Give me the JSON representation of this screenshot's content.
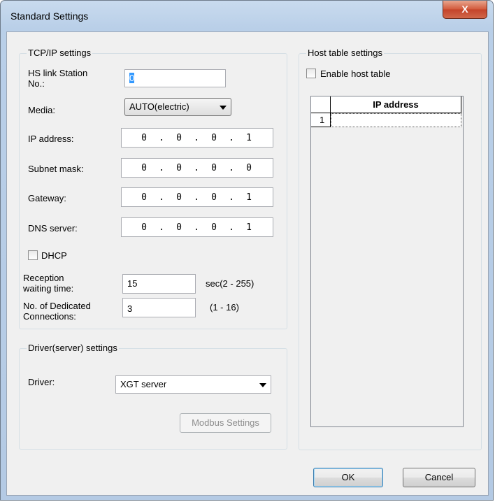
{
  "window": {
    "title": "Standard Settings",
    "close_glyph": "X"
  },
  "tcpip": {
    "legend": "TCP/IP settings",
    "hs_link_label_1": "HS link Station",
    "hs_link_label_2": "No.:",
    "hs_link_value": "0",
    "media_label": "Media:",
    "media_value": "AUTO(electric)",
    "ip_label": "IP address:",
    "ip": [
      "0",
      "0",
      "0",
      "1"
    ],
    "subnet_label": "Subnet mask:",
    "subnet": [
      "0",
      "0",
      "0",
      "0"
    ],
    "gateway_label": "Gateway:",
    "gateway": [
      "0",
      "0",
      "0",
      "1"
    ],
    "dns_label": "DNS server:",
    "dns": [
      "0",
      "0",
      "0",
      "1"
    ],
    "dhcp_label": "DHCP",
    "reception_label_1": "Reception",
    "reception_label_2": "waiting time:",
    "reception_value": "15",
    "reception_range": "sec(2 - 255)",
    "dedicated_label_1": "No. of Dedicated",
    "dedicated_label_2": "Connections:",
    "dedicated_value": "3",
    "dedicated_range": "(1 - 16)"
  },
  "driver": {
    "legend": "Driver(server) settings",
    "driver_label": "Driver:",
    "driver_value": "XGT server",
    "modbus_button": "Modbus Settings"
  },
  "host": {
    "legend": "Host table settings",
    "enable_label": "Enable host table",
    "column_header": "IP address",
    "rows": [
      "1"
    ]
  },
  "buttons": {
    "ok": "OK",
    "cancel": "Cancel"
  },
  "colors": {
    "title_bar": "#b9cfe8",
    "close_button": "#c4432a",
    "dialog_bg": "#f0f0f0"
  }
}
